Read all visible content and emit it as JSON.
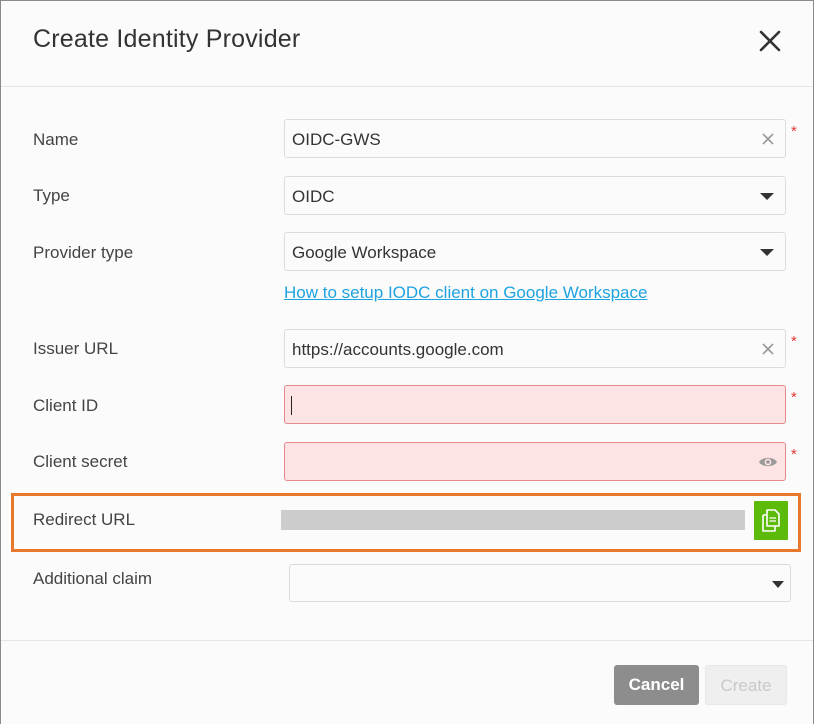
{
  "dialog": {
    "title": "Create Identity Provider"
  },
  "form": {
    "name": {
      "label": "Name",
      "value": "OIDC-GWS",
      "required": "*"
    },
    "type": {
      "label": "Type",
      "value": "OIDC"
    },
    "provider_type": {
      "label": "Provider type",
      "value": "Google Workspace"
    },
    "help_link": "How to setup IODC client on Google Workspace",
    "issuer_url": {
      "label": "Issuer URL",
      "value": "https://accounts.google.com",
      "required": "*"
    },
    "client_id": {
      "label": "Client ID",
      "value": "",
      "required": "*"
    },
    "client_secret": {
      "label": "Client secret",
      "value": "",
      "required": "*"
    },
    "redirect_url": {
      "label": "Redirect URL"
    },
    "additional_claim": {
      "label": "Additional claim",
      "value": ""
    }
  },
  "footer": {
    "cancel_label": "Cancel",
    "create_label": "Create"
  },
  "colors": {
    "error_bg": "#fde3e3",
    "error_border": "#e5898c",
    "link": "#1ea3e0",
    "highlight": "#e8792c",
    "copy_button": "#5cba0b",
    "required": "#e53935"
  },
  "icons": {
    "close": "close-icon",
    "clear": "clear-icon",
    "dropdown": "chevron-down-icon",
    "visibility": "eye-icon",
    "copy": "copy-icon"
  }
}
